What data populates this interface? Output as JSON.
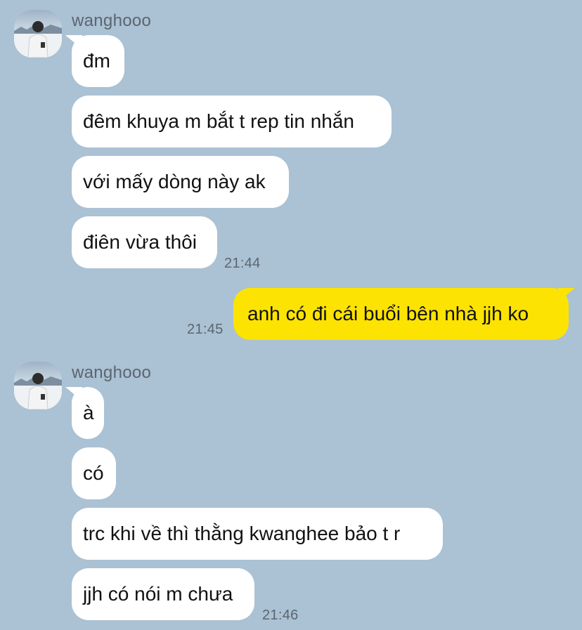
{
  "colors": {
    "background": "#abc1d4",
    "incoming_bubble": "#ffffff",
    "outgoing_bubble": "#fde301",
    "meta_text": "#5b6670"
  },
  "groups": [
    {
      "sender": "wanghooo",
      "messages": [
        "đm",
        "đêm khuya m bắt t rep tin nhắn",
        "với mấy dòng này ak",
        "điên vừa thôi"
      ],
      "time": "21:44"
    },
    {
      "sender": "me",
      "messages": [
        "anh có đi cái buổi bên nhà jjh ko"
      ],
      "time": "21:45"
    },
    {
      "sender": "wanghooo",
      "messages": [
        "à",
        "có",
        "trc khi về thì thằng kwanghee bảo t r",
        "jjh có nói m chưa"
      ],
      "time": "21:46"
    }
  ]
}
